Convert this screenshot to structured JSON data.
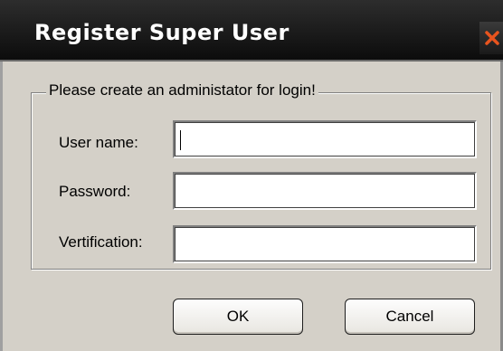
{
  "window": {
    "title": "Register Super User",
    "close_icon": "close-icon",
    "accent_close": "#e8541e"
  },
  "group": {
    "legend": "Please create an administator for login!"
  },
  "fields": [
    {
      "label": "User name:",
      "value": "",
      "focused": true
    },
    {
      "label": "Password:",
      "value": ""
    },
    {
      "label": "Vertification:",
      "value": ""
    }
  ],
  "buttons": {
    "ok_label": "OK",
    "cancel_label": "Cancel"
  }
}
